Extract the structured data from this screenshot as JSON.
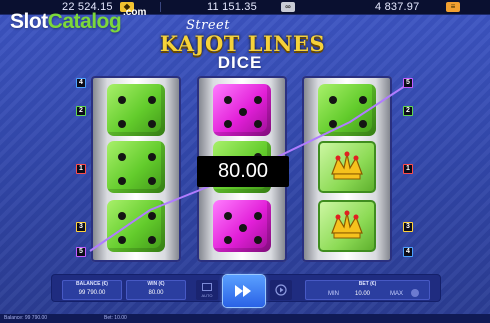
{
  "topbar": {
    "balance": "22 524.15",
    "jackpot_gold": "11 151.35",
    "jackpot_silver": "4 837.97"
  },
  "watermark": {
    "slot": "Slot",
    "catalog": "Catalog",
    "com": ".com"
  },
  "title": {
    "street": "Street",
    "main": "KAJOT LINES",
    "sub": "DICE"
  },
  "reels": [
    [
      "green-4",
      "green-4",
      "green-4"
    ],
    [
      "magenta-5",
      "green-2",
      "magenta-5"
    ],
    [
      "green-4",
      "jester",
      "jester"
    ]
  ],
  "line_markers_left": [
    "4",
    "2",
    "1",
    "3",
    "5"
  ],
  "line_markers_right": [
    "5",
    "2",
    "1",
    "3",
    "4"
  ],
  "win_amount": "80.00",
  "panel": {
    "balance_label": "BALANCE (€)",
    "balance_value": "99 790.00",
    "win_label": "WIN (€)",
    "win_value": "80.00",
    "bet_label": "BET (€)",
    "bet_value": "10.00",
    "bet_minus": "MIN",
    "bet_plus": "MAX",
    "auto_label": "AUTO"
  },
  "footer": {
    "left": "Balance: 99 790.00",
    "center": "Bet: 10.00"
  },
  "colors": {
    "accent_gold": "#f6d23a",
    "green_die": "#63cc2c",
    "magenta_die": "#e21fd8",
    "spin_button": "#2a62e6"
  }
}
